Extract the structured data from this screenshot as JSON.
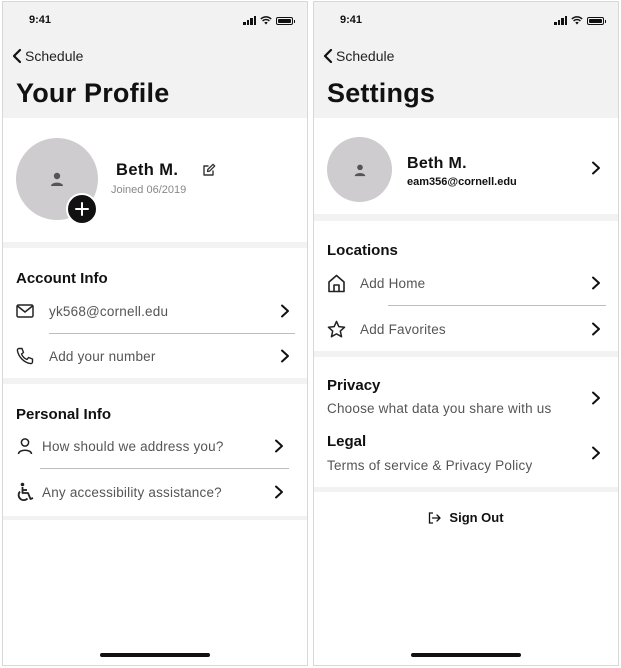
{
  "status_bar": {
    "time": "9:41"
  },
  "profile_screen": {
    "back_label": "Schedule",
    "title": "Your Profile",
    "user": {
      "name": "Beth M.",
      "joined": "Joined 06/2019"
    },
    "account_info": {
      "title": "Account Info",
      "email": "yk568@cornell.edu",
      "phone_placeholder": "Add your number"
    },
    "personal_info": {
      "title": "Personal Info",
      "address_prompt": "How should we address you?",
      "accessibility_prompt": "Any accessibility assistance?"
    }
  },
  "settings_screen": {
    "back_label": "Schedule",
    "title": "Settings",
    "user": {
      "name": "Beth M.",
      "email": "eam356@cornell.edu"
    },
    "locations": {
      "title": "Locations",
      "add_home": "Add Home",
      "add_favorites": "Add Favorites"
    },
    "privacy": {
      "title": "Privacy",
      "subtitle": "Choose what data you share with us"
    },
    "legal": {
      "title": "Legal",
      "subtitle": "Terms of service & Privacy Policy"
    },
    "sign_out": "Sign Out"
  },
  "icons": {
    "back": "chevron-left-icon",
    "edit": "edit-icon",
    "add_photo": "plus-icon",
    "email": "mail-icon",
    "phone": "phone-icon",
    "person": "person-icon",
    "accessibility": "wheelchair-icon",
    "home": "home-icon",
    "favorites": "star-icon",
    "sign_out": "sign-out-icon",
    "chevron": "chevron-right-icon"
  },
  "colors": {
    "background": "#f2f2f2",
    "card": "#ffffff",
    "avatar": "#cfcccf",
    "text": "#111111",
    "muted_text": "#555555",
    "divider": "#bdbdbd"
  }
}
